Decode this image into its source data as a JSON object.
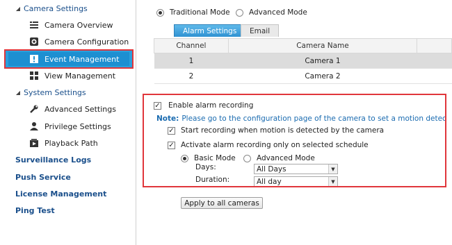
{
  "sidebar": {
    "camera_settings": "Camera Settings",
    "camera_overview": "Camera Overview",
    "camera_configuration": "Camera Configuration",
    "event_management": "Event Management",
    "view_management": "View Management",
    "system_settings": "System Settings",
    "advanced_settings": "Advanced Settings",
    "privilege_settings": "Privilege Settings",
    "playback_path": "Playback Path",
    "surveillance_logs": "Surveillance Logs",
    "push_service": "Push Service",
    "license_management": "License Management",
    "ping_test": "Ping Test"
  },
  "mode": {
    "traditional": "Traditional Mode",
    "advanced": "Advanced Mode",
    "selected": "traditional"
  },
  "tabs": {
    "alarm_settings": "Alarm Settings",
    "email": "Email"
  },
  "table": {
    "col_channel": "Channel",
    "col_camera_name": "Camera Name",
    "rows": [
      {
        "channel": "1",
        "name": "Camera 1"
      },
      {
        "channel": "2",
        "name": "Camera 2"
      }
    ]
  },
  "alarm": {
    "enable_label": "Enable alarm recording",
    "note_label": "Note:",
    "note_text": "Please go to the configuration page of the camera to set a motion detection ar",
    "start_motion_label": "Start recording when motion is detected by the camera",
    "schedule_label": "Activate alarm recording only on selected schedule",
    "basic_mode": "Basic Mode",
    "advanced_mode": "Advanced Mode",
    "days_label": "Days:",
    "days_value": "All Days",
    "duration_label": "Duration:",
    "duration_value": "All day"
  },
  "apply_button": "Apply to all cameras",
  "colors": {
    "highlight_red": "#e0363b",
    "selected_blue": "#2aa0dc",
    "link_blue": "#1a4f8b"
  }
}
